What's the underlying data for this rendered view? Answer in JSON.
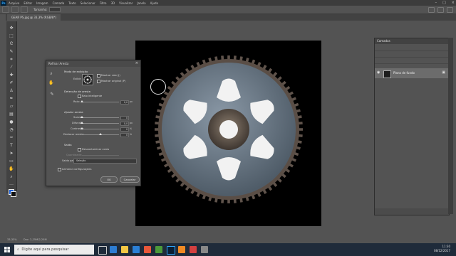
{
  "menubar": {
    "logo": "Ps",
    "items": [
      "Arquivo",
      "Editar",
      "Imagem",
      "Camada",
      "Texto",
      "Selecionar",
      "Filtro",
      "3D",
      "Visualizar",
      "Janela",
      "Ajuda"
    ]
  },
  "options_bar": {
    "size_label": "Tamanho:",
    "size_value": ""
  },
  "document_tab": {
    "label": "GEAR PS.jpg @ 33,3% (RGB/8*)"
  },
  "dialog": {
    "title": "Refinar Aresta",
    "view_mode_header": "Modo de exibição",
    "view_label": "Exibir:",
    "show_radius": "Mostrar raio (J)",
    "show_original": "Mostrar original (P)",
    "edge_detection_header": "Detecção de aresta",
    "smart_radius": "Raio inteligente",
    "radius_label": "Raio:",
    "radius_value": "0,0",
    "radius_unit": "px",
    "adjust_edge_header": "Ajustar aresta",
    "smooth_label": "Suave:",
    "smooth_value": "0",
    "feather_label": "Difundir:",
    "feather_value": "0,0",
    "feather_unit": "px",
    "contrast_label": "Contraste:",
    "contrast_value": "0",
    "contrast_unit": "%",
    "shift_edge_label": "Deslocar aresta:",
    "shift_edge_value": "0",
    "shift_edge_unit": "%",
    "output_header": "Saída",
    "decontaminate": "Descontaminar cores",
    "amount_label": "Quantidade:",
    "output_to_label": "Saída para:",
    "output_to_value": "Seleção",
    "remember": "Lembrar configurações",
    "ok": "OK",
    "cancel": "Cancelar",
    "sliders": {
      "radius": 0.0,
      "smooth": 0.0,
      "feather": 0.0,
      "contrast": 0.0,
      "shift_edge": 0.5
    }
  },
  "layers_panel": {
    "tab": "Camadas",
    "layer_name": "Plano de fundo"
  },
  "status_bar": {
    "zoom": "33,33%",
    "info": "Doc: 2,25M/2,25M"
  },
  "taskbar": {
    "search_placeholder": "Digite aqui para pesquisar",
    "time": "11:30",
    "date": "08/12/2017"
  },
  "colors": {
    "foreground": "#1b5fd8",
    "background": "#111111",
    "accent": "#31a8ff"
  }
}
